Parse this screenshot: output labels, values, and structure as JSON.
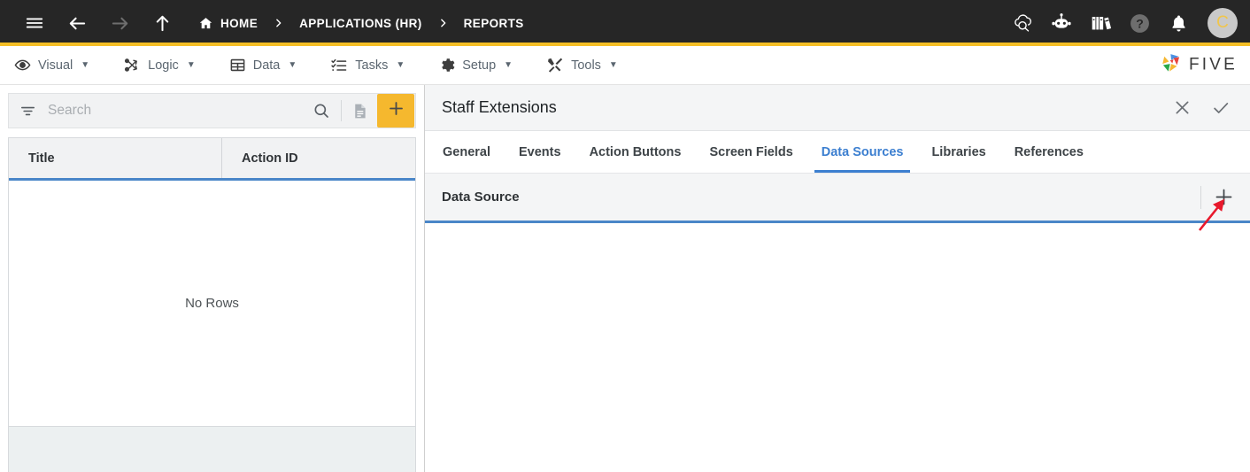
{
  "header": {
    "menu_icon": "hamburger-menu-icon",
    "back_icon": "arrow-left-icon",
    "forward_icon": "arrow-right-icon",
    "up_icon": "arrow-up-icon",
    "breadcrumbs": [
      {
        "label": "HOME",
        "icon": "home-icon"
      },
      {
        "label": "APPLICATIONS (HR)",
        "icon": ""
      },
      {
        "label": "REPORTS",
        "icon": ""
      }
    ],
    "separator": "›",
    "actions": [
      {
        "name": "cloud-search-icon",
        "title": "Cloud"
      },
      {
        "name": "robot-icon",
        "title": "Assistant"
      },
      {
        "name": "books-icon",
        "title": "Documentation"
      },
      {
        "name": "help-icon",
        "title": "Help"
      },
      {
        "name": "bell-icon",
        "title": "Notifications"
      }
    ],
    "avatar_initial": "C",
    "accent_color": "#f5bf26",
    "background_color": "#262626"
  },
  "menubar": {
    "items": [
      {
        "label": "Visual",
        "icon": "eye-icon",
        "caret": "▼"
      },
      {
        "label": "Logic",
        "icon": "flow-icon",
        "caret": "▼"
      },
      {
        "label": "Data",
        "icon": "table-icon",
        "caret": "▼"
      },
      {
        "label": "Tasks",
        "icon": "checklist-icon",
        "caret": "▼"
      },
      {
        "label": "Setup",
        "icon": "gear-icon",
        "caret": "▼"
      },
      {
        "label": "Tools",
        "icon": "tools-icon",
        "caret": "▼"
      }
    ],
    "brand": "FIVE"
  },
  "left_panel": {
    "search": {
      "placeholder": "Search",
      "value": "",
      "filter_icon": "filter-icon",
      "search_icon": "search-icon",
      "document_icon": "document-icon",
      "add_icon": "plus-icon",
      "add_color": "#f5b82e"
    },
    "grid": {
      "columns": [
        "Title",
        "Action ID"
      ],
      "rows": [],
      "empty_message": "No Rows"
    }
  },
  "right_panel": {
    "title": "Staff Extensions",
    "close_icon": "close-icon",
    "confirm_icon": "check-icon",
    "tabs": [
      {
        "label": "General",
        "active": false
      },
      {
        "label": "Events",
        "active": false
      },
      {
        "label": "Action Buttons",
        "active": false
      },
      {
        "label": "Screen Fields",
        "active": false
      },
      {
        "label": "Data Sources",
        "active": true
      },
      {
        "label": "Libraries",
        "active": false
      },
      {
        "label": "References",
        "active": false
      }
    ],
    "active_tab_color": "#3c7fd0",
    "section": {
      "title": "Data Source",
      "add_icon": "plus-icon",
      "rows": []
    }
  },
  "annotation": {
    "type": "arrow",
    "color": "#e8192c",
    "points_to": "data-source-add-button"
  }
}
